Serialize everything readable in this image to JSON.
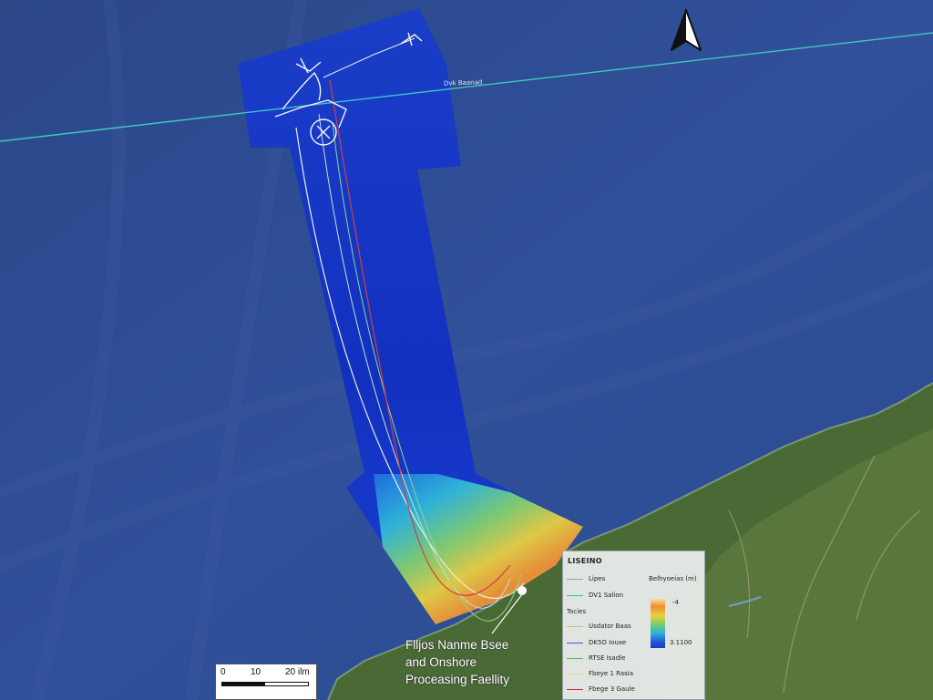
{
  "colors": {
    "ocean": "#2e4a8c",
    "survey_deep": "#1233c8",
    "land": "#4a6a35",
    "track_line": "#3fc8c0",
    "export_route": "#d24040",
    "pipeline": "#e8f0e0"
  },
  "map": {
    "track_label": "Dvk Baanad",
    "compass_icon": "north-arrow-icon"
  },
  "facility": {
    "line1": "Flljos Nanme Bsee",
    "line2": "and Onshore",
    "line3": "Proceasing Faellity"
  },
  "legend": {
    "title": "LISEINO",
    "item0": "Lipes",
    "item1": "DV1 Salion",
    "section": "Tocies",
    "item2": "Usdator Baas",
    "item3": "DK5O Iouxe",
    "item4": "RTSE Isadle",
    "item5": "Fbeye 1 Rasia",
    "item6": "Fbege 3 Gaule",
    "bathy_title": "Belhyoeias (m)",
    "bathy_max": "-4",
    "bathy_min": "3.1100",
    "colors": [
      "#9aa3a8",
      "#3fb8b0",
      "#c8c070",
      "#3060d0",
      "#50c050",
      "#d8d890",
      "#c83030"
    ]
  },
  "scalebar": {
    "l0": "0",
    "l1": "10",
    "l2": "20 ilm"
  }
}
